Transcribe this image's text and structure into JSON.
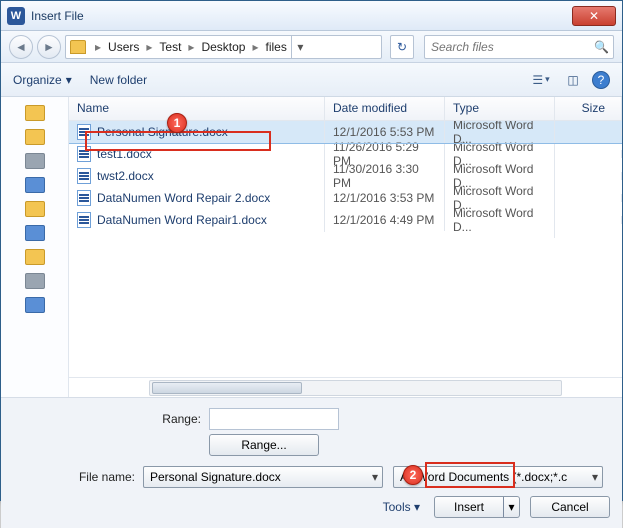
{
  "window": {
    "title": "Insert File",
    "app_glyph": "W"
  },
  "close_glyph": "✕",
  "nav": {
    "back": "◄",
    "forward": "►"
  },
  "breadcrumb": [
    "Users",
    "Test",
    "Desktop",
    "files"
  ],
  "breadcrumb_sep": "▸",
  "breadcrumb_drop": "▾",
  "refresh_glyph": "↻",
  "search": {
    "placeholder": "Search files",
    "icon": "🔍"
  },
  "toolbar": {
    "organize": "Organize",
    "organize_arrow": "▾",
    "newfolder": "New folder",
    "view_glyph": "☰",
    "view_arrow": "▾",
    "help_glyph": "?"
  },
  "columns": {
    "name": "Name",
    "date": "Date modified",
    "type": "Type",
    "size": "Size"
  },
  "files": [
    {
      "name": "Personal Signature.docx",
      "date": "12/1/2016 5:53 PM",
      "type": "Microsoft Word D...",
      "selected": true
    },
    {
      "name": "test1.docx",
      "date": "11/26/2016 5:29 PM",
      "type": "Microsoft Word D...",
      "selected": false
    },
    {
      "name": "twst2.docx",
      "date": "11/30/2016 3:30 PM",
      "type": "Microsoft Word D...",
      "selected": false
    },
    {
      "name": "DataNumen Word Repair 2.docx",
      "date": "12/1/2016 3:53 PM",
      "type": "Microsoft Word D...",
      "selected": false
    },
    {
      "name": "DataNumen Word Repair1.docx",
      "date": "12/1/2016 4:49 PM",
      "type": "Microsoft Word D...",
      "selected": false
    }
  ],
  "range": {
    "label": "Range:",
    "value": "",
    "button": "Range..."
  },
  "filename": {
    "label": "File name:",
    "value": "Personal Signature.docx",
    "drop": "▾"
  },
  "filter": {
    "label": "All Word Documents (*.docx;*.c",
    "drop": "▾"
  },
  "actions": {
    "tools": "Tools",
    "tools_arrow": "▾",
    "insert": "Insert",
    "insert_arrow": "▾",
    "cancel": "Cancel"
  },
  "annotations": {
    "one": "1",
    "two": "2"
  }
}
